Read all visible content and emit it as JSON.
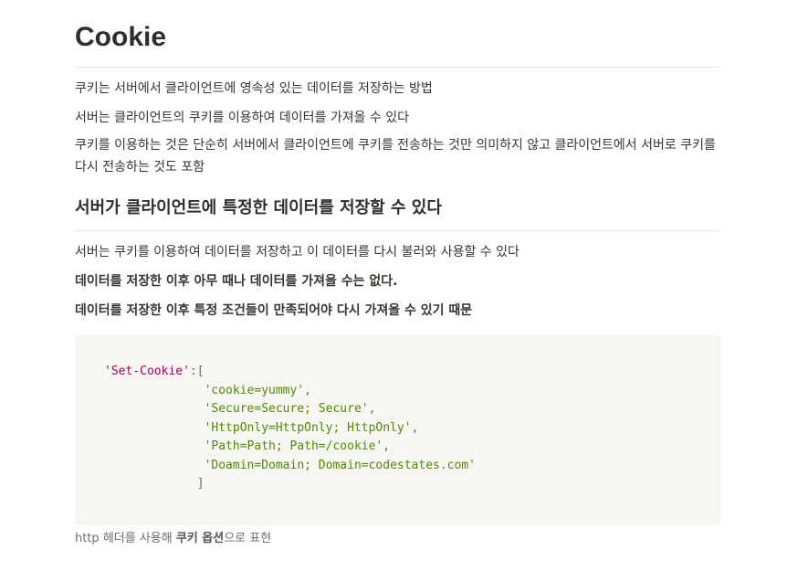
{
  "title": "Cookie",
  "intro": [
    "쿠키는 서버에서 클라이언트에 영속성 있는 데이터를 저장하는 방법",
    "서버는 클라이언트의 쿠키를 이용하여 데이터를 가져올 수 있다",
    "쿠키를 이용하는 것은 단순히 서버에서 클라이언트에 쿠키를 전송하는 것만 의미하지 않고 클라이언트에서 서버로 쿠키를 다시 전송하는 것도 포함"
  ],
  "section": {
    "heading": "서버가 클라이언트에 특정한 데이터를 저장할 수 있다",
    "paragraph": "서버는 쿠키를 이용하여 데이터를 저장하고 이 데이터를 다시 불러와 사용할 수 있다",
    "bold_1": "데이터를 저장한 이후 아무 때나 데이터를 가져올 수는 없다.",
    "bold_2": "데이터를 저장한 이후 특정 조건들이 만족되어야 다시 가져올 수 있기 때문"
  },
  "code": {
    "key": "'Set-Cookie'",
    "open": ":[",
    "items": [
      "'cookie=yummy'",
      "'Secure=Secure; Secure'",
      "'HttpOnly=HttpOnly; HttpOnly'",
      "'Path=Path; Path=/cookie'",
      "'Doamin=Domain; Domain=codestates.com'"
    ],
    "comma": ",",
    "close": "]"
  },
  "caption": {
    "prefix": "http 헤더를 사용해 ",
    "emphasis": "쿠키 옵션",
    "suffix": "으로 표현"
  }
}
